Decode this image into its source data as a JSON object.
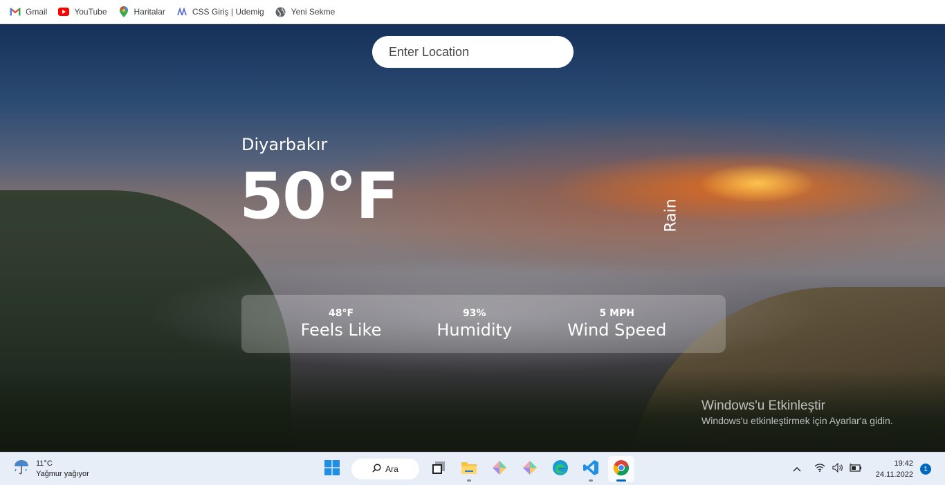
{
  "bookmarks": [
    {
      "label": "Gmail",
      "icon": "gmail-icon"
    },
    {
      "label": "YouTube",
      "icon": "youtube-icon"
    },
    {
      "label": "Haritalar",
      "icon": "maps-icon"
    },
    {
      "label": "CSS Giriş | Udemig",
      "icon": "udemig-icon"
    },
    {
      "label": "Yeni Sekme",
      "icon": "globe-icon"
    }
  ],
  "search": {
    "placeholder": "Enter Location",
    "value": ""
  },
  "weather": {
    "city": "Diyarbakır",
    "temperature": "50°F",
    "condition": "Rain",
    "feels_like_value": "48°F",
    "feels_like_label": "Feels Like",
    "humidity_value": "93%",
    "humidity_label": "Humidity",
    "wind_value": "5 MPH",
    "wind_label": "Wind Speed"
  },
  "activation": {
    "title": "Windows'u Etkinleştir",
    "subtitle": "Windows'u etkinleştirmek için Ayarlar'a gidin."
  },
  "taskbar": {
    "weather_temp": "11°C",
    "weather_desc": "Yağmur yağıyor",
    "search_label": "Ara",
    "time": "19:42",
    "date": "24.11.2022",
    "notification_count": "1"
  },
  "colors": {
    "accent": "#0067c0",
    "taskbar": "#e7eef7",
    "stats_panel": "rgba(255,255,255,0.22)"
  }
}
